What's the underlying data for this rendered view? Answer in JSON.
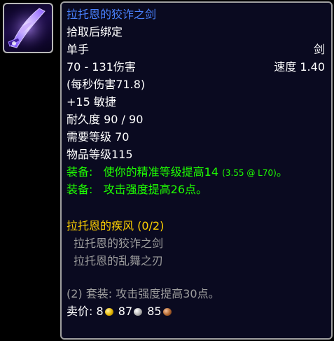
{
  "item": {
    "icon": "sword-icon",
    "name": "拉托恩的狡诈之剑",
    "binding": "拾取后绑定",
    "slot": "单手",
    "type": "剑",
    "damage": "70 - 131伤害",
    "speed": "速度 1.40",
    "dps": "(每秒伤害71.8)",
    "stat": "+15 敏捷",
    "durability": "耐久度 90 / 90",
    "required_level": "需要等级 70",
    "item_level": "物品等级115",
    "equip_1_prefix": "装备:",
    "equip_1_text": "使你的精准等级提高14",
    "equip_1_note": "(3.55 @ L70)",
    "equip_1_end": "。",
    "equip_2_prefix": "装备:",
    "equip_2_text": "攻击强度提高26点。"
  },
  "set": {
    "title": "拉托恩的疾风 (0/2)",
    "pieces": [
      "拉托恩的狡诈之剑",
      "拉托恩的乱舞之刃"
    ],
    "bonus": "(2) 套装: 攻击强度提高30点。"
  },
  "sell": {
    "label": "卖价:",
    "gold": "8",
    "silver": "87",
    "copper": "85"
  },
  "colors": {
    "item_name": "#4a82ff",
    "equip_effect": "#1eff00",
    "set_title": "#ffd100",
    "set_inactive": "#9d9d9d",
    "tooltip_bg": "#0a0a20",
    "border": "#a0a0a0"
  }
}
